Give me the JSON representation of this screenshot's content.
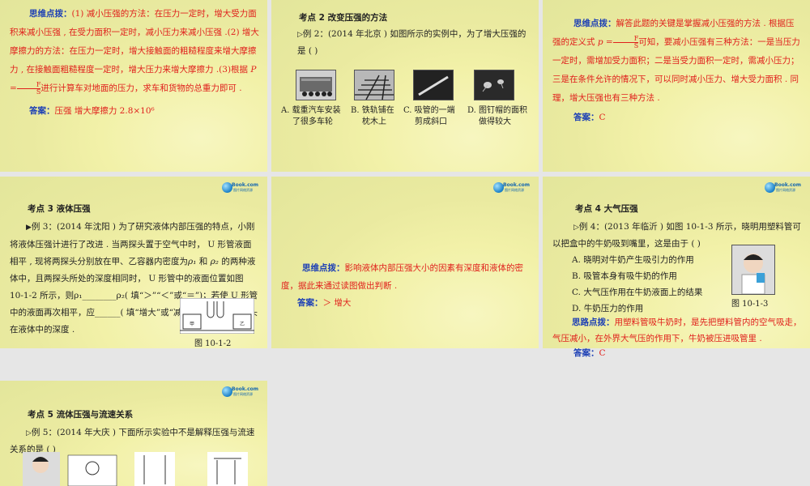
{
  "logo": {
    "name": "Book.com",
    "sub": "图片网络资源"
  },
  "slide1": {
    "label": "思维点拨：",
    "p1": "(1) 减小压强的方法：在压力一定时，增大受力面积来减小压强 , 在受力面积一定时，减小压力来减小压强 .(2) 增大摩擦力的方法：在压力一定时，增大接触面的粗糙程度来增大摩擦力 , 在接触面粗糙程度一定时，增大压力来增大摩擦力 .(3)根据",
    "formula_p": "P =",
    "formula_num": "F",
    "formula_den": "S",
    "p1_tail": "进行计算车对地面的压力，求车和货物的总重力即可 .",
    "answer_label": "答案：",
    "answer": "压强  增大摩擦力     2.8×10⁶"
  },
  "slide2": {
    "title": "考点  2  改变压强的方法",
    "example": "例  2：(2014 年北京 ) 如图所示的实例中，为了增大压强的是 (      )",
    "options": [
      {
        "letter": "A.",
        "text1": "载重汽车安装",
        "text2": "了很多车轮",
        "img": "truck-photo"
      },
      {
        "letter": "B.",
        "text1": "铁轨铺在",
        "text2": "枕木上",
        "img": "railway-photo"
      },
      {
        "letter": "C.",
        "text1": "吸管的一端",
        "text2": "剪成斜口",
        "img": "straw-photo"
      },
      {
        "letter": "D.",
        "text1": "图钉帽的面积",
        "text2": "做得较大",
        "img": "thumbtack-photo"
      }
    ]
  },
  "slide3": {
    "label": "思维点拨：",
    "text_a": "解答此题的关键是掌握减小压强的方法 . 根据压强的定义式",
    "formula_p": "p =",
    "formula_num": "F",
    "formula_den": "S",
    "text_b": "可知，要减小压强有三种方法：一是当压力一定时，需增加受力面积；二是当受力面积一定时，需减小压力；三是在条件允许的情况下，可以同时减小压力、增大受力面积 . 同理，增大压强也有三种方法 .",
    "answer_label": "答案：",
    "answer": "C"
  },
  "slide4": {
    "title": "考点  3  液体压强",
    "example_prefix": "例  3：(2014 年沈阳 )",
    "body_a": "为了研究液体内部压强的特点，小刚将液体压强计进行了改进 . 当两探头置于空气中时，  U 形管液面相平 , 现将两探头分别放在甲、乙容器内密度为",
    "rho1": "ρ₁",
    "and": " 和 ",
    "rho2": "ρ₂",
    "body_b": " 的两种液体中，且两探头所处的深度相同时，  U 形管中的液面位置如图  10-1-2  所示，则",
    "cmp": "ρ₁________ρ₂( 填“＞”“＜”或“＝”)；若使  U 形管中的液面再次相平，应______( 填“增大”或“减小”)乙容器中的探头在液体中的深度 .",
    "figure": "图  10-1-2",
    "jia": "甲",
    "yi": "乙"
  },
  "slide5": {
    "label": "思维点拨：",
    "text": "影响液体内部压强大小的因素有深度和液体的密度，据此来通过读图做出判断 .",
    "answer_label": "答案：",
    "answer": "＞     增大"
  },
  "slide6": {
    "title": "考点  4  大气压强",
    "example": "例  4：(2013 年临沂 ) 如图  10-1-3  所示，晓明用塑料管可以把盒中的牛奶吸到嘴里，这是由于 (      )",
    "options": [
      "A. 晓明对牛奶产生吸引力的作用",
      "B. 吸管本身有吸牛奶的作用",
      "C. 大气压作用在牛奶液面上的结果",
      "D. 牛奶压力的作用"
    ],
    "figure": "图  10-1-3",
    "hint_label": "思路点拨：",
    "hint": "用塑料管吸牛奶时，是先把塑料管内的空气吸走，气压减小，在外界大气压的作用下，牛奶被压进吸管里 .",
    "answer_label": "答案：",
    "answer": "C"
  },
  "slide7": {
    "title": "考点  5  流体压强与流速关系",
    "example": "例  5：(2014 年大庆 ) 下面所示实验中不是解释压强与流速关系的是 (      )"
  }
}
